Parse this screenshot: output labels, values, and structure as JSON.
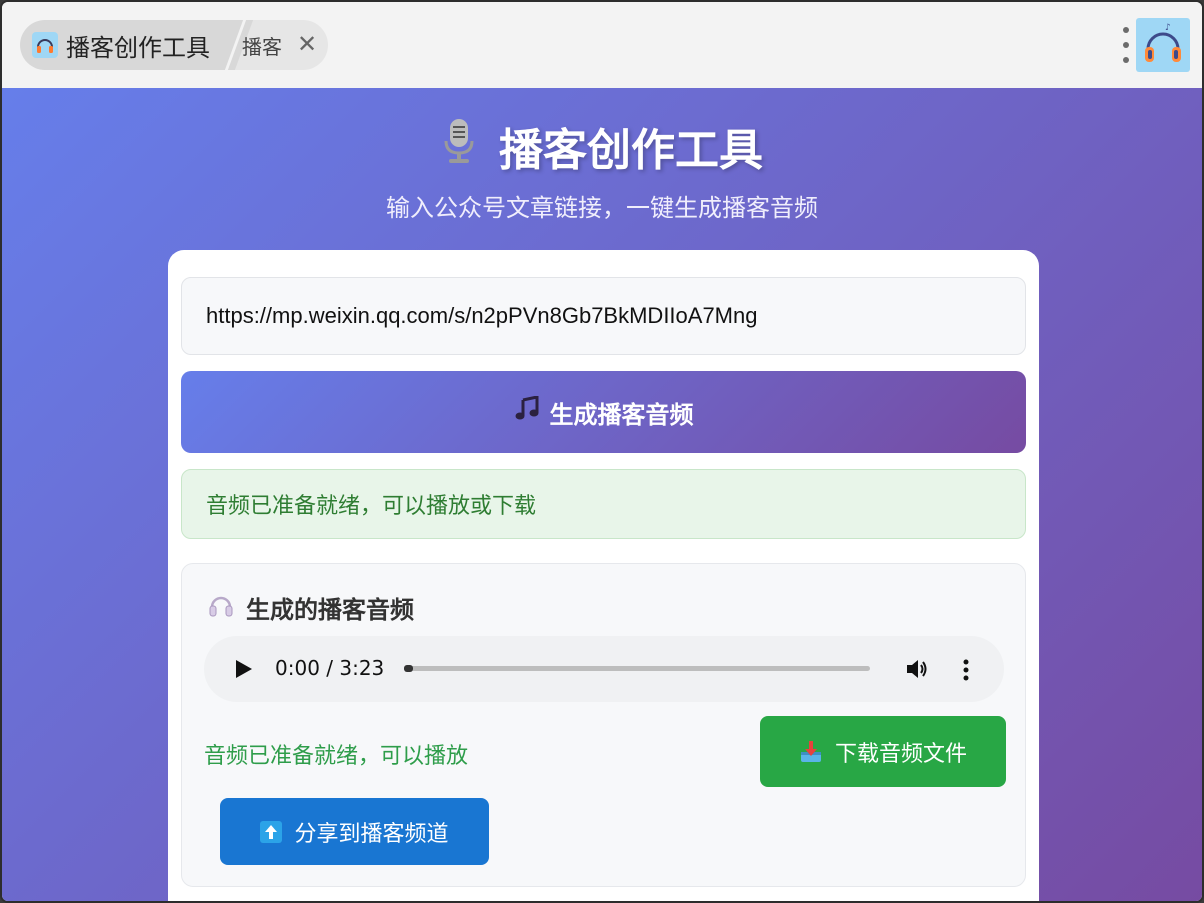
{
  "tab": {
    "title": "播客创作工具",
    "subtitle": "播客",
    "close_glyph": "✕"
  },
  "hero": {
    "title": "播客创作工具",
    "subtitle": "输入公众号文章链接，一键生成播客音频"
  },
  "form": {
    "url_value": "https://mp.weixin.qq.com/s/n2pPVn8Gb7BkMDIIoA7Mng",
    "generate_label": "生成播客音频"
  },
  "status": {
    "message": "音频已准备就绪，可以播放或下载"
  },
  "audio_panel": {
    "title": "生成的播客音频",
    "player": {
      "time": "0:00 / 3:23",
      "progress": 0
    },
    "ready_text": "音频已准备就绪，可以播放",
    "download_label": "下载音频文件",
    "share_label": "分享到播客频道"
  },
  "icons": {
    "tab": "headphones-app-icon",
    "avatar": "headphones-app-icon",
    "hero": "microphone-icon",
    "generate": "music-note-icon",
    "panel": "headphones-icon",
    "download": "download-tray-icon",
    "share": "upload-arrow-icon"
  },
  "colors": {
    "gradient_start": "#667eea",
    "gradient_end": "#764ba2",
    "status_bg": "#e8f5e9",
    "status_text": "#2e7d32",
    "download_bg": "#28a745",
    "share_bg": "#1976d2"
  }
}
